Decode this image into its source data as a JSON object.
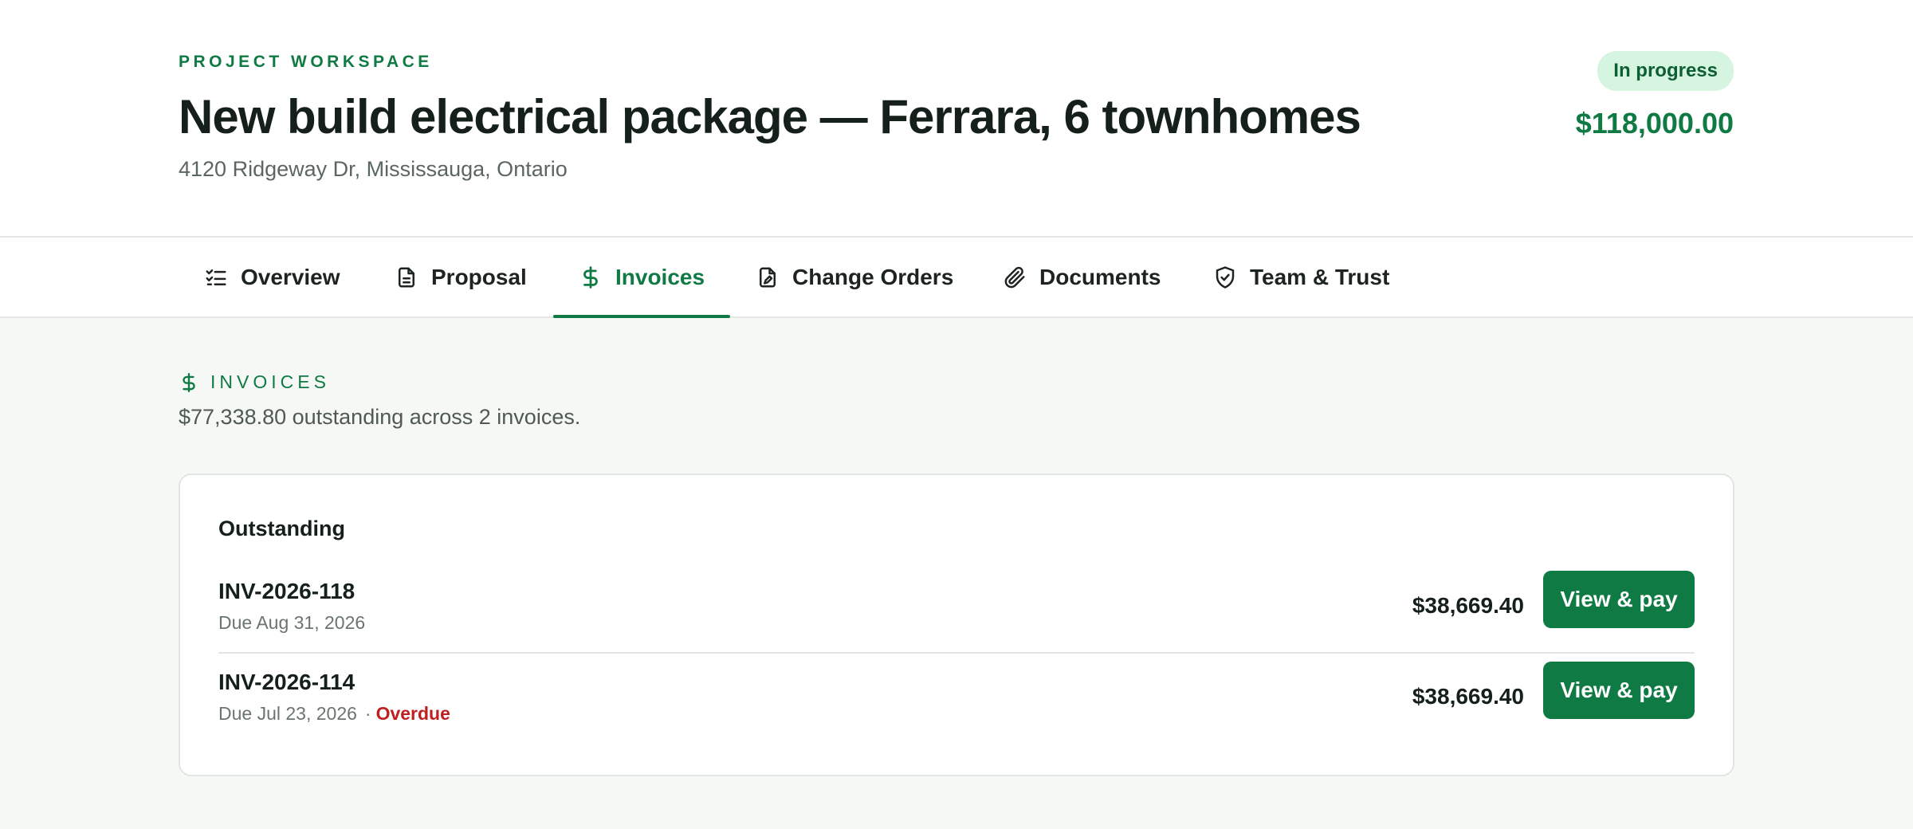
{
  "header": {
    "eyebrow": "PROJECT WORKSPACE",
    "title": "New build electrical package — Ferrara, 6 townhomes",
    "address": "4120 Ridgeway Dr, Mississauga, Ontario",
    "status": "In progress",
    "total": "$118,000.00"
  },
  "tabs": [
    {
      "label": "Overview",
      "icon": "checklist-icon"
    },
    {
      "label": "Proposal",
      "icon": "document-icon"
    },
    {
      "label": "Invoices",
      "icon": "dollar-icon",
      "active": true
    },
    {
      "label": "Change Orders",
      "icon": "document-edit-icon"
    },
    {
      "label": "Documents",
      "icon": "paperclip-icon"
    },
    {
      "label": "Team & Trust",
      "icon": "shield-check-icon"
    }
  ],
  "invoices": {
    "eyebrow": "INVOICES",
    "summary": "$77,338.80 outstanding across 2 invoices.",
    "card_title": "Outstanding",
    "rows": [
      {
        "number": "INV-2026-118",
        "due": "Due Aug 31, 2026",
        "amount": "$38,669.40",
        "action": "View & pay"
      },
      {
        "number": "INV-2026-114",
        "due": "Due Jul 23, 2026",
        "separator": "·",
        "flag": "Overdue",
        "amount": "$38,669.40",
        "action": "View & pay"
      }
    ]
  },
  "colors": {
    "accent": "#0f7a43",
    "badge_bg": "#d6f5e1",
    "overdue": "#c01f1f",
    "page_bg": "#f6f8f6"
  }
}
